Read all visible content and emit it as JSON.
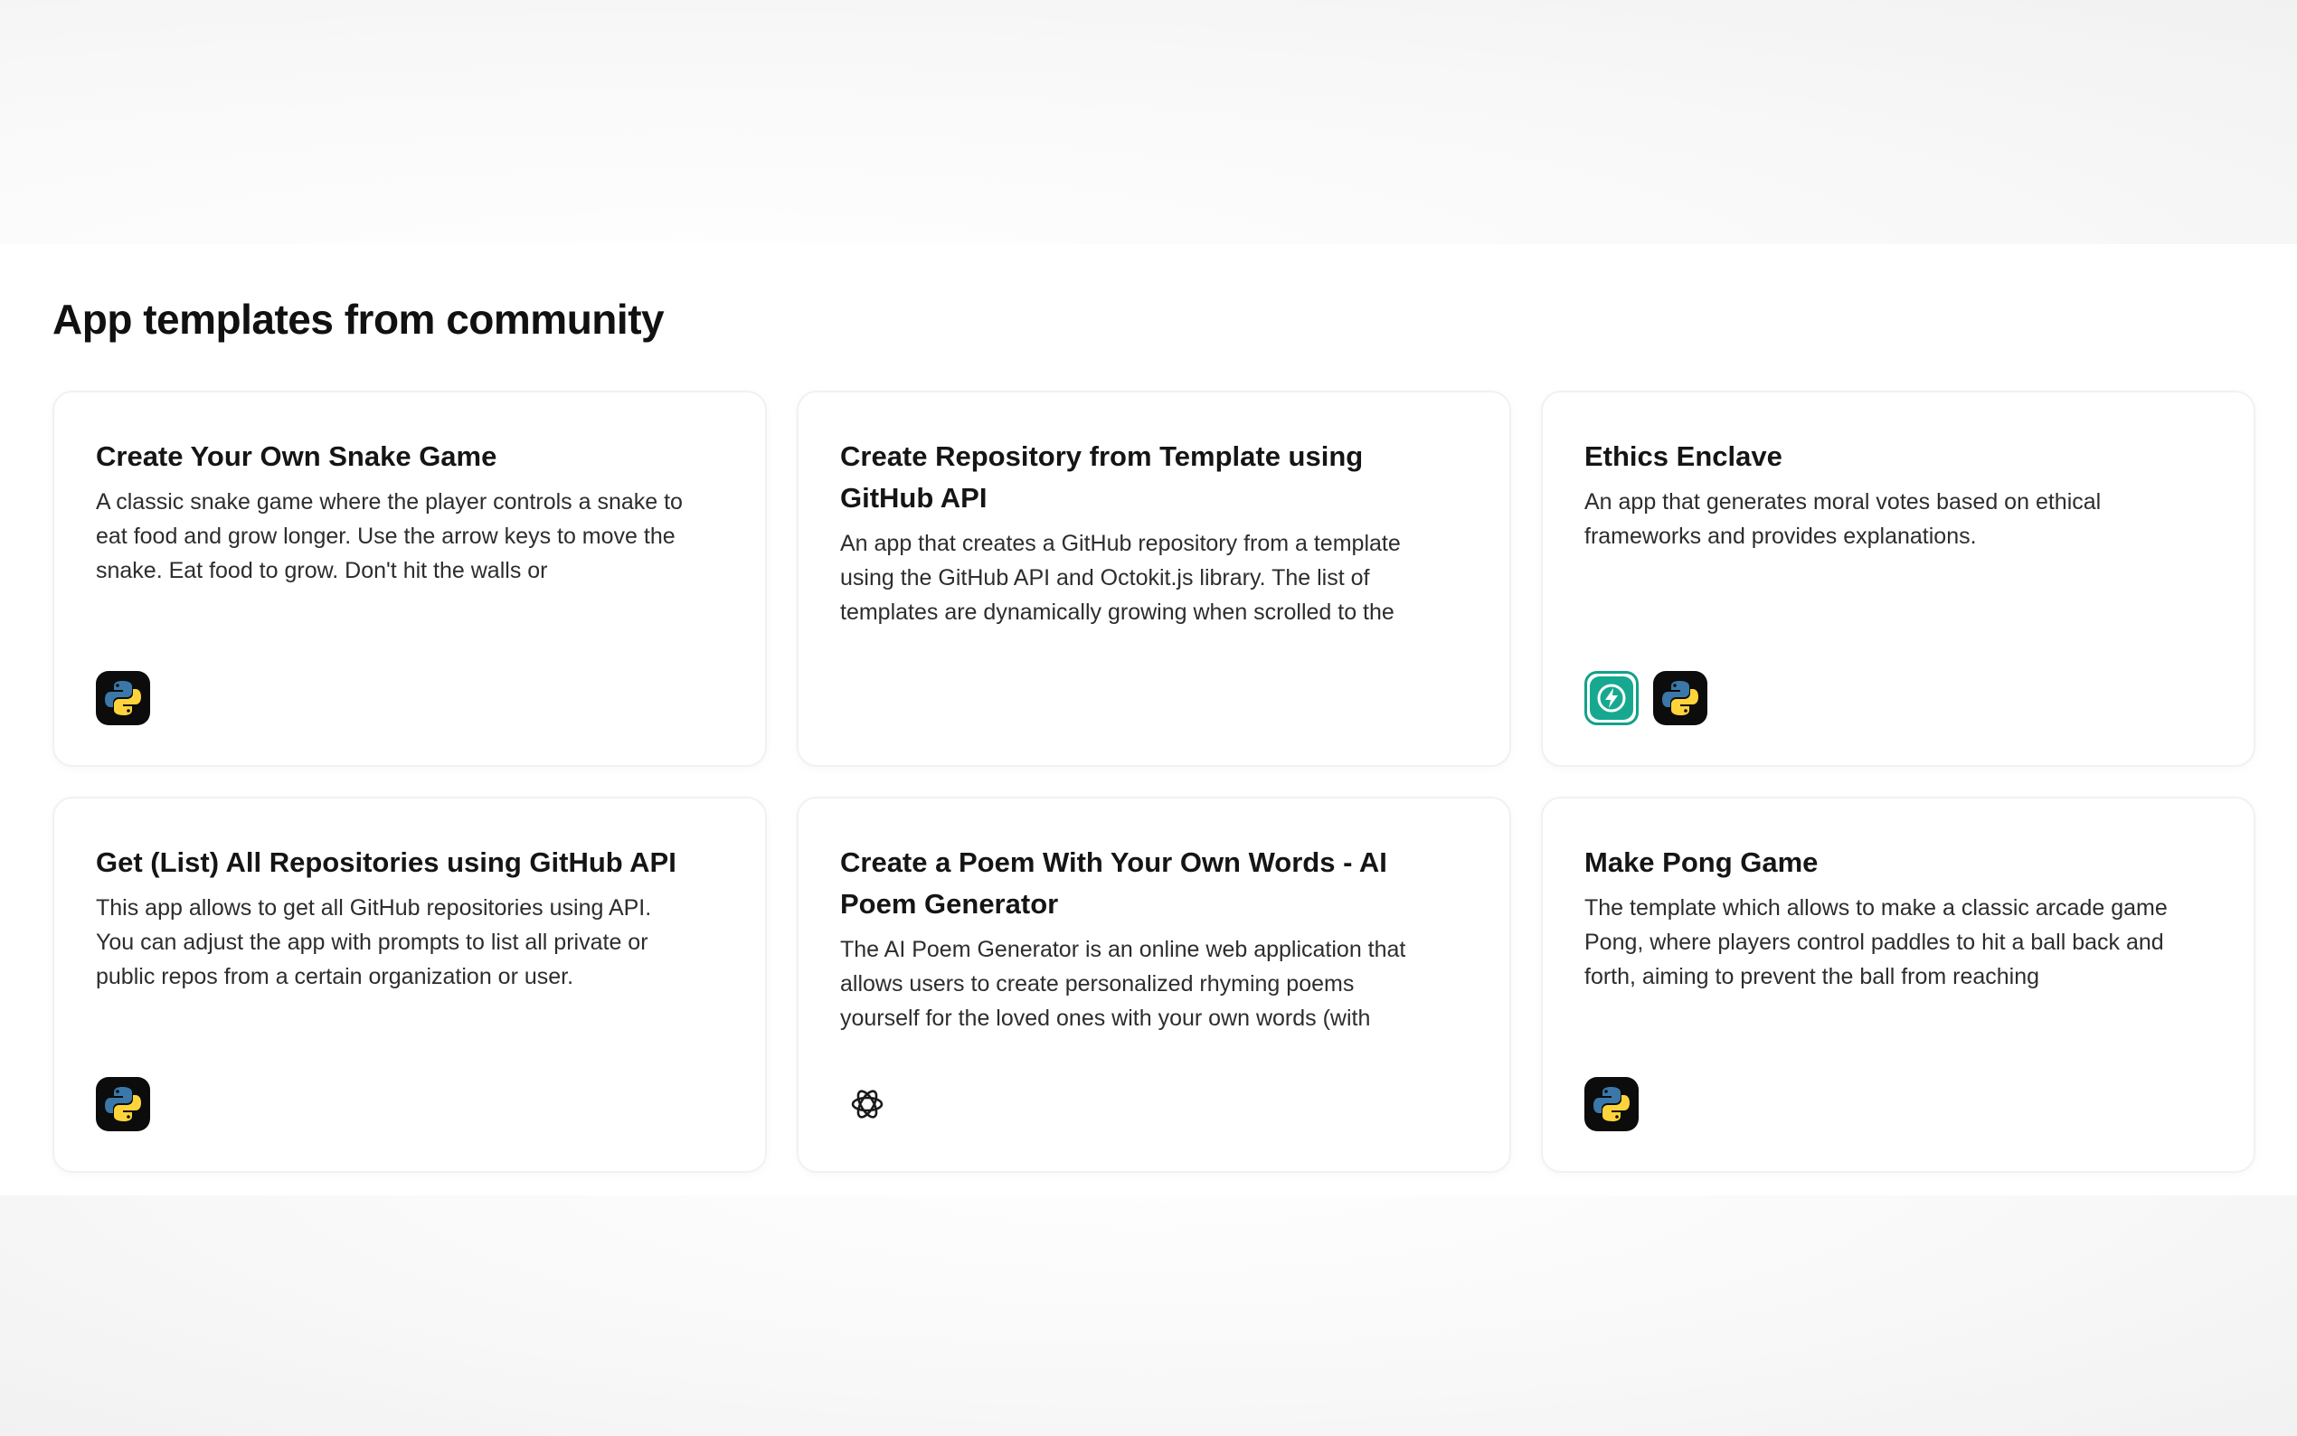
{
  "section": {
    "title": "App templates from community"
  },
  "cards": [
    {
      "title": "Create Your Own Snake Game",
      "description": "A classic snake game where the player controls a snake to eat food and grow longer. Use the arrow keys to move the snake. Eat food to grow. Don't hit the walls or",
      "icons": [
        "python-icon"
      ]
    },
    {
      "title": "Create Repository from Template using GitHub API",
      "description": "An app that creates a GitHub repository from a template using the GitHub API and Octokit.js library. The list of templates are dynamically growing when scrolled to the",
      "icons": []
    },
    {
      "title": "Ethics Enclave",
      "description": "An app that generates moral votes based on ethical frameworks and provides explanations.",
      "icons": [
        "bolt-icon",
        "python-icon"
      ]
    },
    {
      "title": "Get (List) All Repositories using GitHub API",
      "description": "This app allows to get all GitHub repositories using API. You can adjust the app with prompts to list all private or public repos from a certain organization or user.",
      "icons": [
        "python-icon"
      ]
    },
    {
      "title": "Create a Poem With Your Own Words - AI Poem Generator",
      "description": "The AI Poem Generator is an online web application that allows users to create personalized rhyming poems yourself for the loved ones with your own words (with",
      "icons": [
        "openai-icon"
      ]
    },
    {
      "title": "Make Pong Game",
      "description": "The template which allows to make a classic arcade game Pong, where players control paddles to hit a ball back and forth, aiming to prevent the ball from reaching",
      "icons": [
        "python-icon"
      ]
    }
  ],
  "colors": {
    "python_blue": "#3b77a8",
    "python_yellow": "#ffd43b",
    "bolt_teal": "#17a890"
  }
}
